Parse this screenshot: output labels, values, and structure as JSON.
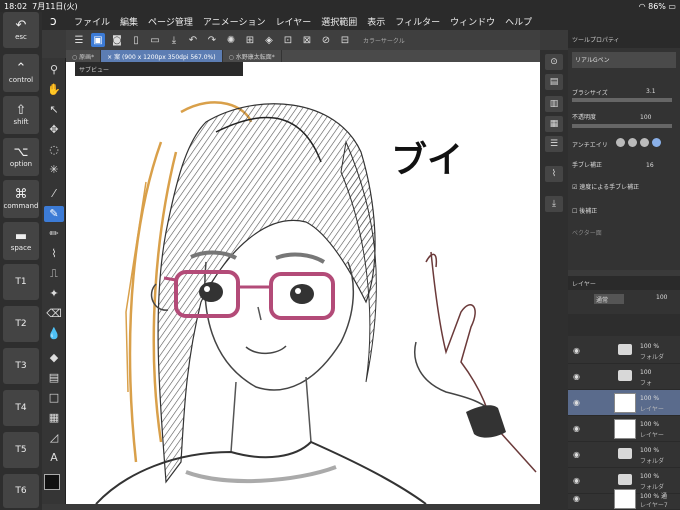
{
  "status": {
    "time": "18:02",
    "date": "7月11日(火)",
    "battery": "86%"
  },
  "menu": [
    "ファイル",
    "編集",
    "ページ管理",
    "アニメーション",
    "レイヤー",
    "選択範囲",
    "表示",
    "フィルター",
    "ウィンドウ",
    "ヘルプ"
  ],
  "keys": [
    {
      "label": "esc",
      "icon": "undo-icon"
    },
    {
      "label": "control",
      "icon": "chevron-up-icon"
    },
    {
      "label": "shift",
      "icon": "arrow-up-icon"
    },
    {
      "label": "option",
      "icon": "option-icon"
    },
    {
      "label": "command",
      "icon": "command-icon"
    },
    {
      "label": "space",
      "icon": "bar-icon"
    },
    {
      "label": "T1"
    },
    {
      "label": "T2"
    },
    {
      "label": "T3"
    },
    {
      "label": "T4"
    },
    {
      "label": "T5"
    },
    {
      "label": "T6"
    }
  ],
  "tabs": [
    "○ 原画*",
    "× 案 (900 x 1200px 350dpi 567.0%)",
    "○ 水野康太転面*"
  ],
  "subview_label": "サブビュー",
  "color_circle_label": "カラーサークル",
  "canvas_text": "ブイ",
  "tool_property": {
    "title": "ツールプロパティ",
    "brush_name": "リアルGペン",
    "brush_size_label": "ブラシサイズ",
    "brush_size": "3.1",
    "opacity_label": "不透明度",
    "opacity": "100",
    "antialias_label": "アンチエイリ",
    "stabilization_label": "手ブレ補正",
    "stabilization": "16",
    "speed_stab_label": "速度による手ブレ補正",
    "post_correction_label": "後補正",
    "vector_label": "ベクター面"
  },
  "layers_panel": {
    "title": "レイヤー",
    "blend": "通常",
    "opacity": "100",
    "rows": [
      {
        "pct": "100 %",
        "name": "フォルダ"
      },
      {
        "pct": "100",
        "name": "フォ"
      },
      {
        "pct": "100 %",
        "name": "レイヤー"
      },
      {
        "pct": "100 %",
        "name": "レイヤー"
      },
      {
        "pct": "100 %",
        "name": "フォルダ"
      },
      {
        "pct": "100 %",
        "name": "フォルダ"
      },
      {
        "pct": "100 % 通",
        "name": "レイヤー7"
      }
    ]
  }
}
